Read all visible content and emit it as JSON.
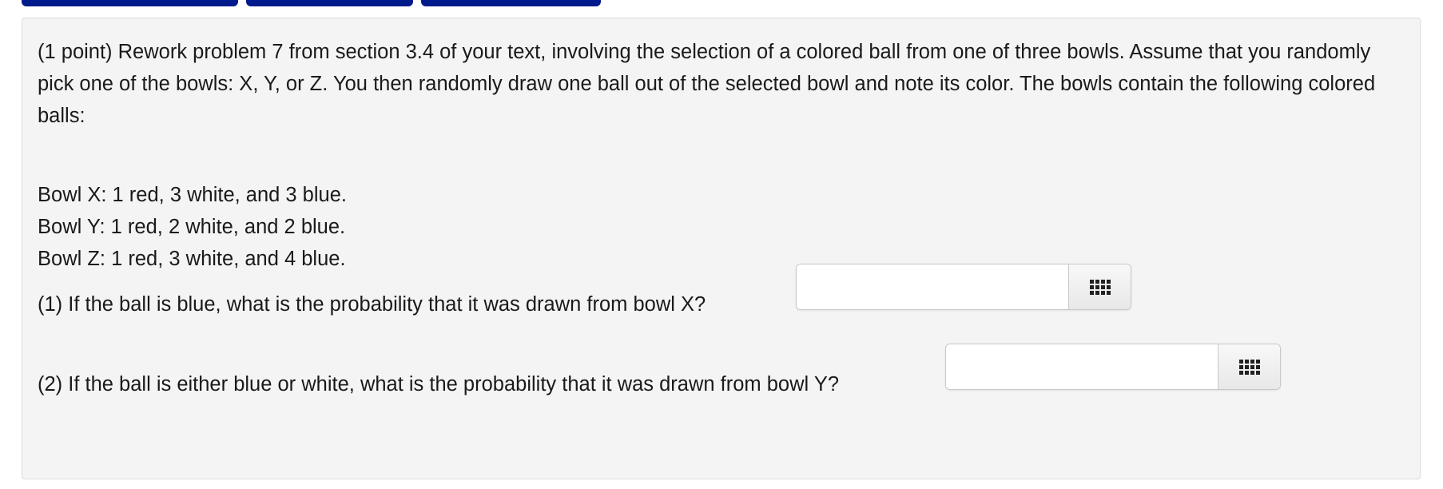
{
  "problem": {
    "intro": "(1 point) Rework problem 7 from section 3.4 of your text, involving the selection of a colored ball from one of three bowls. Assume that you randomly pick one of the bowls: X, Y, or Z. You then randomly draw one ball out of the selected bowl and note its color. The bowls contain the following colored balls:",
    "bowls": [
      "Bowl X: 1 red, 3 white, and 3 blue.",
      "Bowl Y: 1 red, 2 white, and 2 blue.",
      "Bowl Z: 1 red, 3 white, and 4 blue."
    ],
    "questions": [
      {
        "label": "(1) If the ball is blue, what is the probability that it was drawn from bowl X?",
        "value": "",
        "keypad_icon": "keypad-grid-icon"
      },
      {
        "label": "(2) If the ball is either blue or white, what is the probability that it was drawn from bowl Y?",
        "value": "",
        "keypad_icon": "keypad-grid-icon"
      }
    ]
  },
  "colors": {
    "top_tab": "#001a8c",
    "panel_background": "#f4f4f4"
  }
}
